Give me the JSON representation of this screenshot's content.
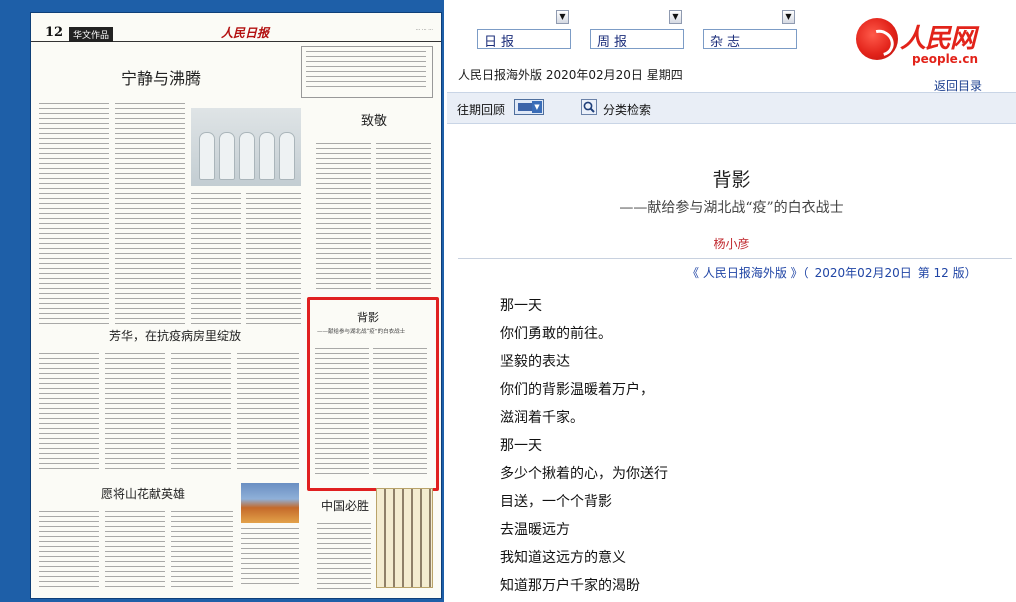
{
  "newspaper": {
    "page_number": "12",
    "section": "华文作品",
    "masthead": "人民日报",
    "headlines": {
      "main": "宁静与沸腾",
      "zhijing": "致敬",
      "fanghua": "芳华，在抗疫病房里绽放",
      "yuanjiang": "愿将山花献英雄",
      "zhongguo": "中国必胜",
      "beiying": "背影",
      "beiying_sub": "——献给参与湖北战“疫”的白衣战士"
    }
  },
  "nav": {
    "tabs": [
      {
        "label": "日报"
      },
      {
        "label": "周报"
      },
      {
        "label": "杂志"
      }
    ],
    "dropdown_icon": "chevron-down-icon"
  },
  "edition_line": "人民日报海外版  2020年02月20日  星期四",
  "toolbar": {
    "past_review": "往期回顾",
    "category_search": "分类检索"
  },
  "logo": {
    "text": "人民网",
    "domain": "people.cn"
  },
  "back_link": "返回目录",
  "article": {
    "title": "背影",
    "subtitle": "——献给参与湖北战“疫”的白衣战士",
    "author": "杨小彦",
    "source": {
      "paper": "《 人民日报海外版 》（",
      "date": "2020年02月20日",
      "page": "第  12  版）"
    },
    "lines": [
      "那一天",
      "你们勇敢的前往。",
      "坚毅的表达",
      "你们的背影温暖着万户，",
      "滋润着千家。",
      "那一天",
      "多少个揪着的心，为你送行",
      "目送，一个个背影",
      "去温暖远方",
      "我知道这远方的意义",
      "知道那万户千家的渴盼"
    ]
  },
  "colors": {
    "left_panel": "#1e5fa8",
    "highlight": "#e02020",
    "logo_red": "#e2231a",
    "link_blue": "#2045a5",
    "author_red": "#c0282e"
  }
}
